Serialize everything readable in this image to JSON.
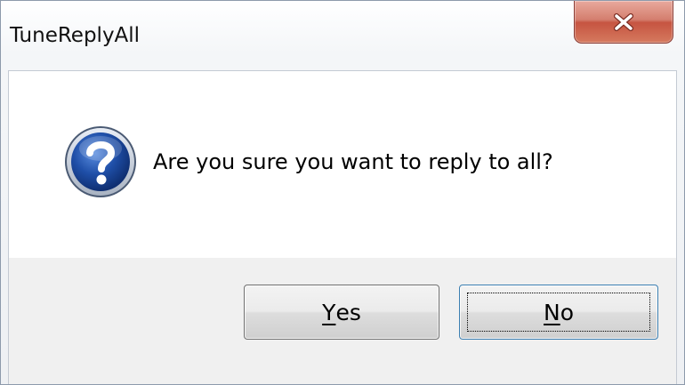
{
  "window": {
    "title": "TuneReplyAll",
    "close_icon": "close-x-icon"
  },
  "message": {
    "icon": "question-icon",
    "text": "Are you sure you want to reply to all?"
  },
  "buttons": {
    "yes": {
      "access_key": "Y",
      "rest": "es"
    },
    "no": {
      "access_key": "N",
      "rest": "o",
      "default": true
    }
  },
  "colors": {
    "close_button": "#c65441",
    "icon_blue": "#1f4fa8",
    "default_button_border": "#3c7fb1"
  }
}
